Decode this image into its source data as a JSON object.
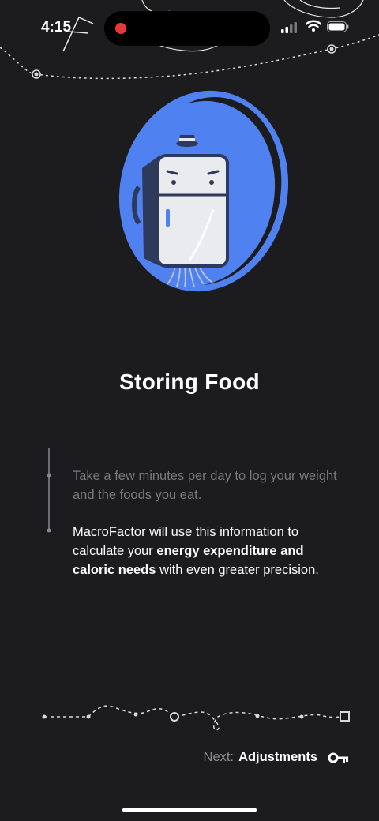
{
  "status_bar": {
    "time": "4:15"
  },
  "illustration": {
    "icon": "fridge-character-illustration",
    "accent_color": "#4f82f0"
  },
  "title": "Storing Food",
  "description": {
    "paragraph1": "Take a few minutes per day to log your weight and the foods you eat.",
    "paragraph2_start": "MacroFactor will use this information to calculate your ",
    "paragraph2_bold": "energy expenditure and caloric needs",
    "paragraph2_end": " with even greater precision."
  },
  "footer": {
    "next_prefix": "Next:",
    "next_target": "Adjustments",
    "next_icon": "key-icon"
  }
}
